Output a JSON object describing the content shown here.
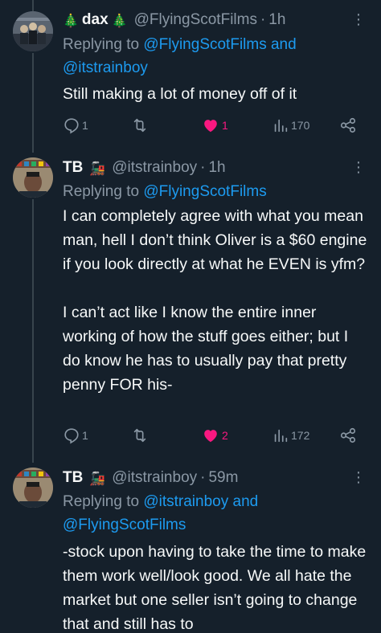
{
  "tweets": [
    {
      "display_name": "dax",
      "name_emoji_left": "🎄",
      "name_emoji_right": "🎄",
      "handle": "@FlyingScotFilms",
      "time": "1h",
      "reply_prefix": "Replying to ",
      "reply_targets_line1": "@FlyingScotFilms and",
      "reply_targets_line2": "@itstrainboy",
      "text": "Still making a lot of money off of it",
      "replies": "1",
      "retweets": "",
      "likes": "1",
      "views": "170"
    },
    {
      "display_name": "TB",
      "name_emoji_right": "🚂",
      "handle": "@itstrainboy",
      "time": "1h",
      "reply_prefix": "Replying to ",
      "reply_targets_line1": "@FlyingScotFilms",
      "text": "I can completely agree with what you mean man, hell I don’t think Oliver is a $60 engine if you look directly at what he EVEN is yfm?\n\nI can’t act like I know the entire inner working of how the stuff goes either; but I do know he has to usually pay that pretty penny FOR his-",
      "replies": "1",
      "retweets": "",
      "likes": "2",
      "views": "172"
    },
    {
      "display_name": "TB",
      "name_emoji_right": "🚂",
      "handle": "@itstrainboy",
      "time": "59m",
      "reply_prefix": "Replying to ",
      "reply_targets_line1": "@itstrainboy and",
      "reply_targets_line2": "@FlyingScotFilms",
      "text": "-stock upon having to take the time to make them work well/look good. We all hate the market but one seller isn’t going to change that and still has to"
    }
  ],
  "separator": "·",
  "more_icon": "⋮",
  "colors": {
    "background": "#15202b",
    "text": "#f7f9f9",
    "muted": "#8b98a5",
    "link": "#1d9bf0",
    "like": "#f91880",
    "thread_line": "#38444d"
  },
  "icons": [
    "reply-icon",
    "retweet-icon",
    "like-icon",
    "views-icon",
    "share-icon",
    "more-icon"
  ]
}
